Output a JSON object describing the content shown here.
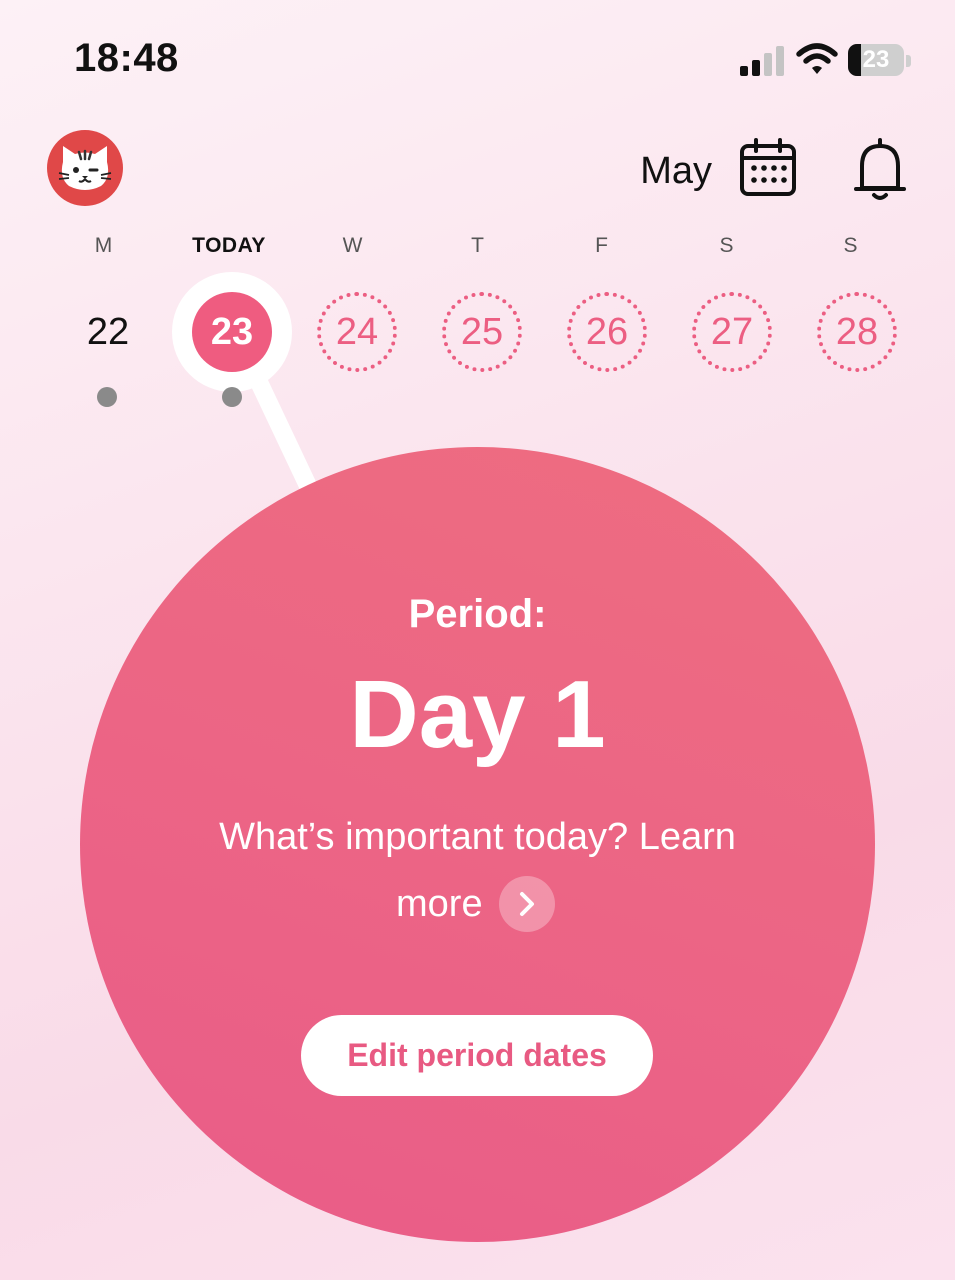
{
  "status_bar": {
    "time": "18:48",
    "battery_level": "23",
    "battery_fraction": 0.23
  },
  "header": {
    "month": "May",
    "icons": {
      "avatar": "cat-avatar-icon",
      "calendar": "calendar-icon",
      "notifications": "bell-icon"
    }
  },
  "week": {
    "labels": [
      "M",
      "TODAY",
      "W",
      "T",
      "F",
      "S",
      "S"
    ],
    "days": [
      "22",
      "23",
      "24",
      "25",
      "26",
      "27",
      "28"
    ],
    "today_index": 1,
    "logged_dot_days": [
      "22",
      "23"
    ]
  },
  "cycle_card": {
    "label": "Period:",
    "day": "Day 1",
    "tip": "What’s important today? Learn",
    "tip_more": "more",
    "edit_button": "Edit period dates"
  },
  "colors": {
    "accent": "#ef5c80",
    "circle": "#ec6585",
    "avatar": "#e04848"
  }
}
